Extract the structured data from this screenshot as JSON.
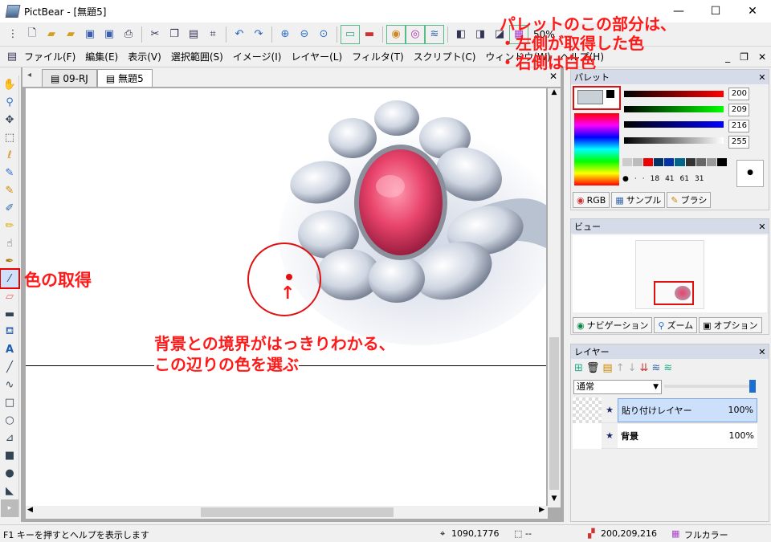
{
  "window": {
    "title": "PictBear - [無題5]",
    "minimize": "—",
    "maximize": "☐",
    "close": "✕"
  },
  "toolbar": {
    "zoom": "50%"
  },
  "menu": [
    "ファイル(F)",
    "編集(E)",
    "表示(V)",
    "選択範囲(S)",
    "イメージ(I)",
    "レイヤー(L)",
    "フィルタ(T)",
    "スクリプト(C)",
    "ウィンドウ(W)",
    "ヘルプ(H)"
  ],
  "tabs": [
    {
      "label": "09-RJ"
    },
    {
      "label": "無題5"
    }
  ],
  "annotations": {
    "palette_note_line1": "パレットのこの部分は、",
    "palette_note_line2": "・左側が取得した色",
    "palette_note_line3": "・右側は白色",
    "tool_note": "色の取得",
    "canvas_note_line1": "背景との境界がはっきりわかる、",
    "canvas_note_line2": "この辺りの色を選ぶ",
    "arrow": "↑",
    "color_accent": "#ff1a1a"
  },
  "palette": {
    "title": "パレット",
    "r": "200",
    "g": "209",
    "b": "216",
    "a": "255",
    "brush_sizes": [
      "18",
      "41",
      "61",
      "31"
    ],
    "tabs": [
      "RGB",
      "サンプル",
      "ブラシ"
    ]
  },
  "view": {
    "title": "ビュー",
    "tabs": [
      "ナビゲーション",
      "ズーム",
      "オプション"
    ]
  },
  "layers": {
    "title": "レイヤー",
    "mode": "通常",
    "items": [
      {
        "name": "貼り付けレイヤー",
        "opacity": "100%"
      },
      {
        "name": "背景",
        "opacity": "100%"
      }
    ]
  },
  "status": {
    "help": "F1 キーを押すとヘルプを表示します",
    "coords": "1090,1776",
    "size": "--",
    "color": "200,209,216",
    "mode": "フルカラー"
  }
}
